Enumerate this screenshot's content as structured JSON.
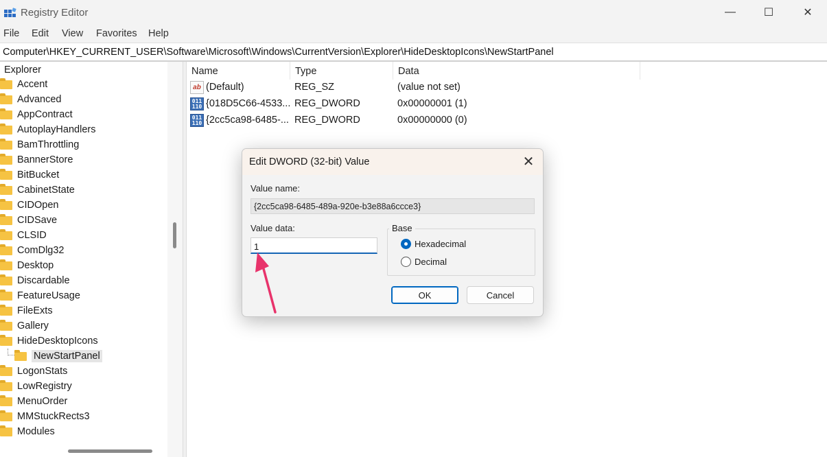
{
  "window": {
    "title": "Registry Editor",
    "minimize_glyph": "—",
    "maximize_glyph": "☐",
    "close_glyph": "✕"
  },
  "menu": [
    "File",
    "Edit",
    "View",
    "Favorites",
    "Help"
  ],
  "address": "Computer\\HKEY_CURRENT_USER\\Software\\Microsoft\\Windows\\CurrentVersion\\Explorer\\HideDesktopIcons\\NewStartPanel",
  "tree": {
    "root": "Explorer",
    "items": [
      "Accent",
      "Advanced",
      "AppContract",
      "AutoplayHandlers",
      "BamThrottling",
      "BannerStore",
      "BitBucket",
      "CabinetState",
      "CIDOpen",
      "CIDSave",
      "CLSID",
      "ComDlg32",
      "Desktop",
      "Discardable",
      "FeatureUsage",
      "FileExts",
      "Gallery",
      "HideDesktopIcons",
      "NewStartPanel",
      "LogonStats",
      "LowRegistry",
      "MenuOrder",
      "MMStuckRects3",
      "Modules"
    ],
    "selected": "NewStartPanel"
  },
  "list": {
    "columns": [
      "Name",
      "Type",
      "Data"
    ],
    "rows": [
      {
        "icon": "string-value-icon",
        "name": "(Default)",
        "type": "REG_SZ",
        "data": "(value not set)"
      },
      {
        "icon": "binary-value-icon",
        "name": "{018D5C66-4533...",
        "type": "REG_DWORD",
        "data": "0x00000001 (1)"
      },
      {
        "icon": "binary-value-icon",
        "name": "{2cc5ca98-6485-...",
        "type": "REG_DWORD",
        "data": "0x00000000 (0)"
      }
    ]
  },
  "dialog": {
    "title": "Edit DWORD (32-bit) Value",
    "value_name_label": "Value name:",
    "value_name": "{2cc5ca98-6485-489a-920e-b3e88a6ccce3}",
    "value_data_label": "Value data:",
    "value_data": "1",
    "base_label": "Base",
    "radio_hex": "Hexadecimal",
    "radio_dec": "Decimal",
    "selected_base": "Hexadecimal",
    "ok_label": "OK",
    "cancel_label": "Cancel"
  },
  "annotation": {
    "color": "#e8336b"
  },
  "colors": {
    "accent": "#0067c0",
    "folder": "#f6c343"
  }
}
